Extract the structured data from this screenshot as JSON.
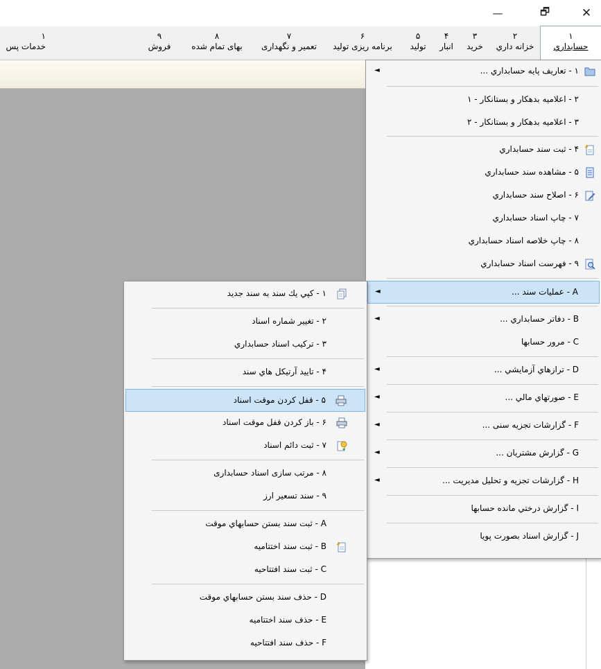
{
  "window_controls": {
    "minimize": "—",
    "maximize": "🗗",
    "close": "✕"
  },
  "menubar": {
    "tabs": [
      {
        "num": "١",
        "label": "حسابداري"
      },
      {
        "num": "٢",
        "label": "خزانه داري"
      },
      {
        "num": "٣",
        "label": "خريد"
      },
      {
        "num": "۴",
        "label": "انبار"
      },
      {
        "num": "۵",
        "label": "توليد"
      },
      {
        "num": "۶",
        "label": "برنامه ریزی تولید"
      },
      {
        "num": "٧",
        "label": "تعمیر و نگهداری"
      },
      {
        "num": "٨",
        "label": "بهای تمام شده"
      },
      {
        "num": "٩",
        "label": "فروش"
      },
      {
        "num": "١",
        "label": "خدمات پس"
      }
    ]
  },
  "main_menu": {
    "items": [
      {
        "label": "١ - تعاريف پايه حسابداري ...",
        "arrow": "◄",
        "icon": "folder-icon"
      },
      {
        "label": "٢ - اعلاميه بدهكار و بستانكار - ١"
      },
      {
        "label": "٣ - اعلاميه بدهكار و بستانكار - ٢"
      },
      {
        "label": "۴ - ثبت سند حسابداري",
        "icon": "new-document-icon"
      },
      {
        "label": "۵ - مشاهده سند حسابداري",
        "icon": "view-document-icon"
      },
      {
        "label": "۶ - اصلاح سند حسابداري",
        "icon": "edit-document-icon"
      },
      {
        "label": "٧ - چاپ اسناد حسابداري"
      },
      {
        "label": "٨ - چاپ خلاصه اسناد حسابداري"
      },
      {
        "label": "٩ - فهرست اسناد حسابداري",
        "icon": "search-document-icon"
      },
      {
        "label": "A - عمليات سند ...",
        "arrow": "◄"
      },
      {
        "label": "B - دفاتر حسابداري ...",
        "arrow": "◄"
      },
      {
        "label": "C - مرور حسابها"
      },
      {
        "label": "D - ترازهاي آزمايشي ...",
        "arrow": "◄"
      },
      {
        "label": "E - صورتهاي مالي ...",
        "arrow": "◄"
      },
      {
        "label": "F - گزارشات تجزيه سنی ...",
        "arrow": "◄"
      },
      {
        "label": "G - گزارش مشتريان ...",
        "arrow": "◄"
      },
      {
        "label": "H - گزارشات تجزيه و تحليل مديريت ...",
        "arrow": "◄"
      },
      {
        "label": "I - گزارش درختي مانده حسابها"
      },
      {
        "label": "J - گزارش اسناد بصورت پويا"
      }
    ]
  },
  "sub_menu": {
    "items": [
      {
        "label": "١ - كپي يك سند به سند جديد",
        "icon": "copy-document-icon"
      },
      {
        "label": "٢ - تغيير شماره اسناد"
      },
      {
        "label": "٣ - تركيب اسناد حسابداري"
      },
      {
        "label": "۴ - تاييد آرتيكل هاي سند"
      },
      {
        "label": "۵ - قفل كردن موقت اسناد",
        "icon": "lock-printer-icon"
      },
      {
        "label": "۶ - باز كردن قفل موقت اسناد",
        "icon": "unlock-printer-icon"
      },
      {
        "label": "٧ - ثبت دائم اسناد",
        "icon": "permanent-record-icon"
      },
      {
        "label": "٨ - مرتب سازی اسناد حسابداری"
      },
      {
        "label": "٩ - سند تسعير ارز"
      },
      {
        "label": "A - ثبت سند بستن حسابهاي موقت"
      },
      {
        "label": "B - ثبت سند اختتاميه",
        "icon": "new-document-icon"
      },
      {
        "label": "C - ثبت سند افتتاحيه"
      },
      {
        "label": "D - حذف سند بستن حسابهاي موقت"
      },
      {
        "label": "E - حذف سند اختتاميه"
      },
      {
        "label": "F - حذف سند افتتاحيه"
      }
    ]
  }
}
